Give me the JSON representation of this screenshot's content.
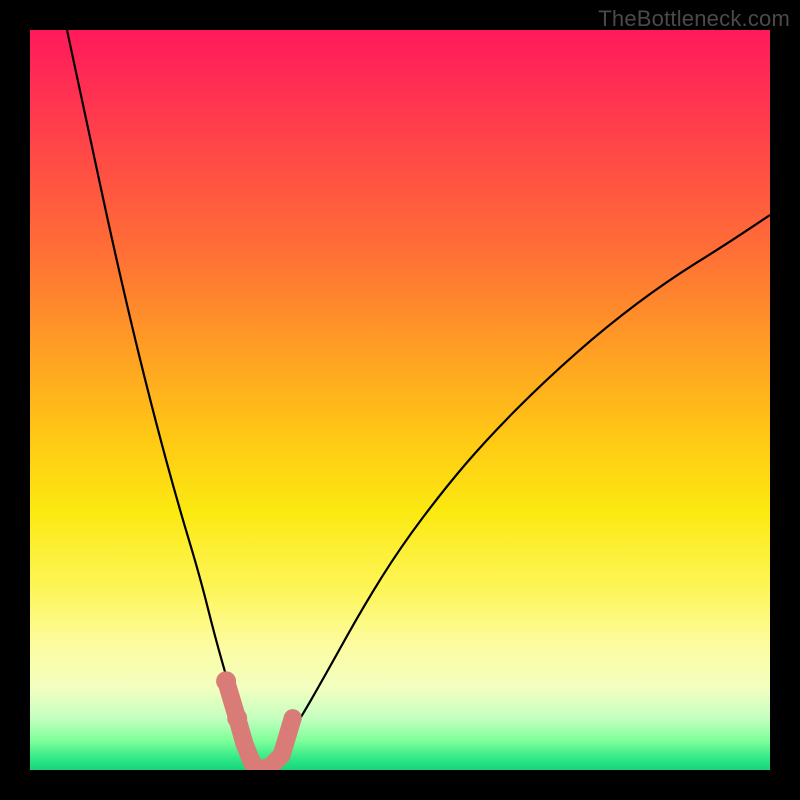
{
  "watermark": "TheBottleneck.com",
  "colors": {
    "curve": "#000000",
    "highlight": "#d97b76"
  },
  "chart_data": {
    "type": "line",
    "title": "",
    "xlabel": "",
    "ylabel": "",
    "xrange": [
      0,
      100
    ],
    "yrange": [
      0,
      100
    ],
    "description": "Two monotone curves descending into a narrow valley at x≈31 with pct≈0, rising asymmetrically. Background is a heat gradient from red (top, high bottleneck) to green (bottom, 0%).",
    "series": [
      {
        "name": "left-branch",
        "x": [
          5,
          8,
          11,
          14,
          17,
          20,
          23,
          25,
          27,
          28.5,
          30,
          31
        ],
        "pct": [
          100,
          86,
          72,
          59,
          47,
          36,
          26,
          18,
          11,
          6,
          2,
          0
        ]
      },
      {
        "name": "right-branch",
        "x": [
          31,
          33,
          36,
          40,
          45,
          50,
          56,
          62,
          70,
          78,
          86,
          94,
          100
        ],
        "pct": [
          0,
          2,
          6,
          13,
          22,
          30,
          38,
          45,
          53,
          60,
          66,
          71,
          75
        ]
      }
    ],
    "valley_highlight": {
      "x": [
        26.5,
        28,
        29,
        30,
        31,
        32.5,
        34,
        35.5
      ],
      "pct": [
        12,
        7,
        3.5,
        1,
        0,
        0.5,
        2,
        7
      ]
    },
    "valley_dots": [
      {
        "x": 26.5,
        "pct": 12
      },
      {
        "x": 28.0,
        "pct": 7
      },
      {
        "x": 35.5,
        "pct": 7
      },
      {
        "x": 34.0,
        "pct": 2
      }
    ],
    "gradient_stops": [
      {
        "pos": 0.0,
        "color": "#ff1a5a"
      },
      {
        "pos": 0.3,
        "color": "#ff6f36"
      },
      {
        "pos": 0.55,
        "color": "#ffc815"
      },
      {
        "pos": 0.76,
        "color": "#fdf65c"
      },
      {
        "pos": 0.93,
        "color": "#c4ffc0"
      },
      {
        "pos": 1.0,
        "color": "#17d47b"
      }
    ]
  }
}
